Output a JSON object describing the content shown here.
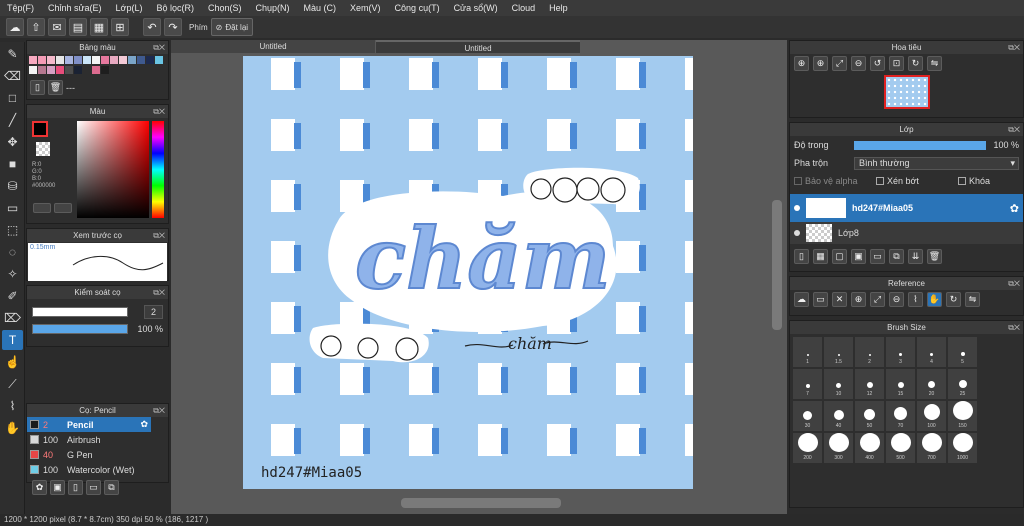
{
  "menu": [
    "Tệp(F)",
    "Chỉnh sửa(E)",
    "Lớp(L)",
    "Bộ lọc(R)",
    "Chọn(S)",
    "Chụp(N)",
    "Màu (C)",
    "Xem(V)",
    "Công cụ(T)",
    "Cửa sổ(W)",
    "Cloud",
    "Help"
  ],
  "toolbar": {
    "phim_label": "Phím",
    "reset_label": "Đặt lại"
  },
  "tabs": {
    "tab1": "Untitled",
    "tab2": "Untitled"
  },
  "palette": {
    "title": "Bảng màu",
    "more": "---",
    "colors": [
      "#f7a9c0",
      "#f49bb6",
      "#f4b9cb",
      "#e6e6e6",
      "#a8b5e0",
      "#7f8fc7",
      "#c9e4f7",
      "#f4f4f4",
      "#e6789e",
      "#e8a9c0",
      "#f3cad6",
      "#7ba5c9",
      "#3f5a8f",
      "#1d2a4f",
      "#6ac5e4",
      "#f4f4f4",
      "#b67890",
      "#d6a0c3",
      "#e84d7b",
      "#4d4d4d",
      "#1a2233",
      "#2e2e2e",
      "#dc6b8f",
      "#1e1e1e"
    ]
  },
  "color": {
    "title": "Màu",
    "r": "R:0",
    "g": "G:0",
    "b": "B:0",
    "hex": "#000000"
  },
  "brush_preview": {
    "title": "Xem trước cọ",
    "size": "0.15mm"
  },
  "brush_control": {
    "title": "Kiểm soát cọ",
    "size": "2",
    "opacity": "100 %"
  },
  "brush_list": {
    "title": "Cọ: Pencil",
    "items": [
      {
        "size": "2",
        "name": "Pencil",
        "color": "#1a1a1a"
      },
      {
        "size": "100",
        "name": "Airbrush",
        "color": "#d8d8d8"
      },
      {
        "size": "40",
        "name": "G Pen",
        "color": "#e64545"
      },
      {
        "size": "100",
        "name": "Watercolor (Wet)",
        "color": "#6fcde6"
      }
    ]
  },
  "artwork": {
    "main_text": "chăm",
    "sub_text": "chăm",
    "signature": "hd247#Miaa05"
  },
  "navigator": {
    "title": "Hoa tiêu"
  },
  "layers": {
    "title": "Lớp",
    "opacity_label": "Độ trong",
    "opacity_value": "100 %",
    "blend_label": "Pha trộn",
    "blend_value": "Bình thường",
    "protect_alpha": "Bảo vệ alpha",
    "clip": "Xén bớt",
    "lock": "Khóa",
    "items": [
      {
        "name": "hd247#Miaa05",
        "selected": true
      },
      {
        "name": "Lớp8",
        "selected": false
      }
    ]
  },
  "reference": {
    "title": "Reference"
  },
  "brush_size": {
    "title": "Brush Size",
    "sizes": [
      "1",
      "1.5",
      "2",
      "3",
      "4",
      "5",
      "7",
      "10",
      "12",
      "15",
      "20",
      "25",
      "30",
      "40",
      "50",
      "70",
      "100",
      "150",
      "200",
      "300",
      "400",
      "500",
      "700",
      "1000"
    ]
  },
  "status": {
    "text": "1200 * 1200 pixel   (8.7 * 8.7cm)   350 dpi   50 %   (186, 1217 )"
  }
}
